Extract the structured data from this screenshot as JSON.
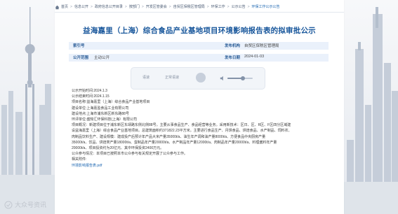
{
  "breadcrumb": {
    "items": [
      "首页",
      "信息公开",
      "政府信息公开目录",
      "按部门",
      "开发区管委会",
      "自贸区保税区管理局",
      "环保工作",
      "公示公告"
    ],
    "current": "环保工作公示公告"
  },
  "article": {
    "title": "益海嘉里（上海）综合食品产业基地项目环境影响报告表的拟审批公示",
    "meta": {
      "index_label": "索引号",
      "index_value": "",
      "publisher_label": "发布机构",
      "publisher_value": "自贸区保税区管理局",
      "scope_label": "公开范围",
      "scope_value": "主动公开",
      "date_label": "发布日期",
      "date_value": "2024-01-03"
    },
    "player": {
      "left_label": "语速",
      "right_label": "正常语速",
      "volume_label": "音量",
      "progress": 0.62
    },
    "body_lines": [
      "公示开始时间:2024.1.3",
      "公示结束时间:2024.1.15",
      "项目名称:益海嘉里（上海）综合食品产业基地项目",
      "建设单位:上海嘉盈食品工业有限公司",
      "建设地点:上海市浦东新区新东路88号",
      "环评单位:盛知汇环保科技(上海）有限公司",
      "项目概况：新建项目位于浦东新区东靖路东侧北侧88号。主要从事食品生产、食品经营等业务。采用新技术：区日、区、R区、F区四分区域建",
      "设益海嘉里（上海）综合食品产业基地项目。总建筑面积约371822.23平方米。主要进行食品生产、月饼食品、烘焙食品、水产制品、饲料农、",
      "肉制品饮料生产、建设规模：建成投产后预计年产品大米产量35000t/a、油生年产调和油产量8000t/a、方便食品中央厨房产量",
      "35000t/a、饮品、烘焙类产量18000t/a、蛋制品年产量20000t/a、水产制品年产量12000t/a、肉制品年产量20000t/a、料理酱料年产量",
      "20000t/a、项目投资约为20亿元、其中环保投资2400万元。",
      "公众参与情况：本项目已按照本市公众参与有关规定开展了公众参与工作。",
      "相关附件:"
    ],
    "attachment_label": "环境影响报告表",
    "attachment_ext": ".pdf"
  },
  "watermark": {
    "text": "大众号资讯"
  }
}
